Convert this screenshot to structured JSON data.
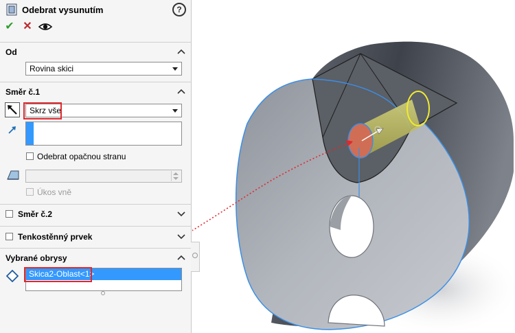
{
  "panel": {
    "title": "Odebrat vysunutím",
    "help_icon": "?",
    "actions": {
      "ok": "✔",
      "cancel": "✕"
    },
    "od": {
      "title": "Od",
      "value": "Rovina skici"
    },
    "direction1": {
      "title": "Směr č.1",
      "end_condition": "Skrz vše",
      "reverse_side_label": "Odebrat opačnou stranu",
      "draft_outward_label": "Úkos vně"
    },
    "direction2": {
      "title": "Směr č.2"
    },
    "thin_feature": {
      "title": "Tenkostěnný prvek"
    },
    "selected_contours": {
      "title": "Vybrané obrysy",
      "items": [
        "Skica2-Oblast<1>"
      ]
    }
  },
  "colors": {
    "accent_red": "#e0282e",
    "selection_blue": "#3399ff",
    "ok_green": "#2e9e2e",
    "cancel_red": "#c0282e"
  }
}
